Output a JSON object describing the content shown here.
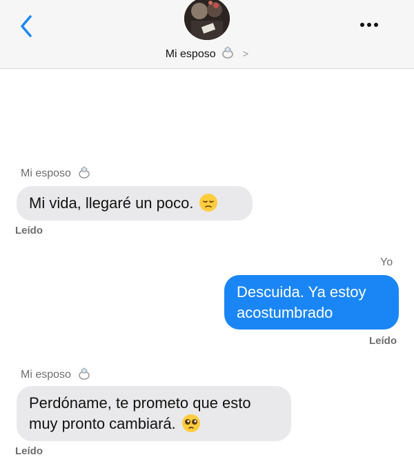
{
  "header": {
    "contact_name": "Mi esposo",
    "contact_emoji": "ring-icon",
    "chevron": ">"
  },
  "messages": [
    {
      "sender": "Mi esposo",
      "direction": "incoming",
      "text": "Mi vida, llegaré un poco.",
      "emoji": "pensive-face",
      "status": "Leído"
    },
    {
      "sender": "Yo",
      "direction": "outgoing",
      "lines": [
        "Descuida. Ya estoy",
        "acostumbrado"
      ],
      "status": "Leído"
    },
    {
      "sender": "Mi esposo",
      "direction": "incoming",
      "lines": [
        "Perdóname, te prometo que esto",
        "muy pronto cambiará."
      ],
      "emoji": "pleading-face",
      "status": "Leído"
    }
  ],
  "colors": {
    "outgoing_bubble": "#1a86f5",
    "incoming_bubble": "#e9e9eb",
    "accent": "#1a86f5"
  }
}
